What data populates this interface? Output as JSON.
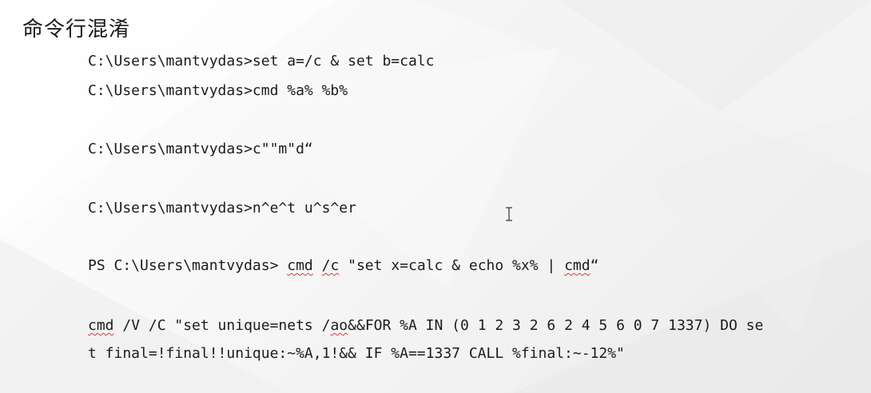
{
  "slide": {
    "title": "命令行混淆"
  },
  "lines": [
    {
      "text": "C:\\Users\\mantvydas>set a=/c & set b=calc"
    },
    {
      "text": "C:\\Users\\mantvydas>cmd %a% %b%"
    },
    {
      "text": "C:\\Users\\mantvydas>c\"\"m\"d“"
    },
    {
      "text": "C:\\Users\\mantvydas>n^e^t u^s^er"
    },
    {
      "prefix": "PS C:\\Users\\mantvydas> ",
      "w1": "cmd",
      "mid1": " ",
      "w2": "/c",
      "mid2": " \"set x=calc & echo %x% | ",
      "w3": "cmd",
      "suffix": "“"
    },
    {
      "w1": "cmd",
      "mid1": " /V /C \"set unique=nets /",
      "w2": "ao",
      "suffix": "&&FOR %A IN (0 1 2 3 2 6 2 4 5 6 0 7 1337) DO se"
    },
    {
      "text": "t final=!final!!unique:~%A,1!&& IF %A==1337 CALL %final:~-12%\""
    }
  ],
  "icons": {
    "cursor": "text-cursor-icon"
  }
}
